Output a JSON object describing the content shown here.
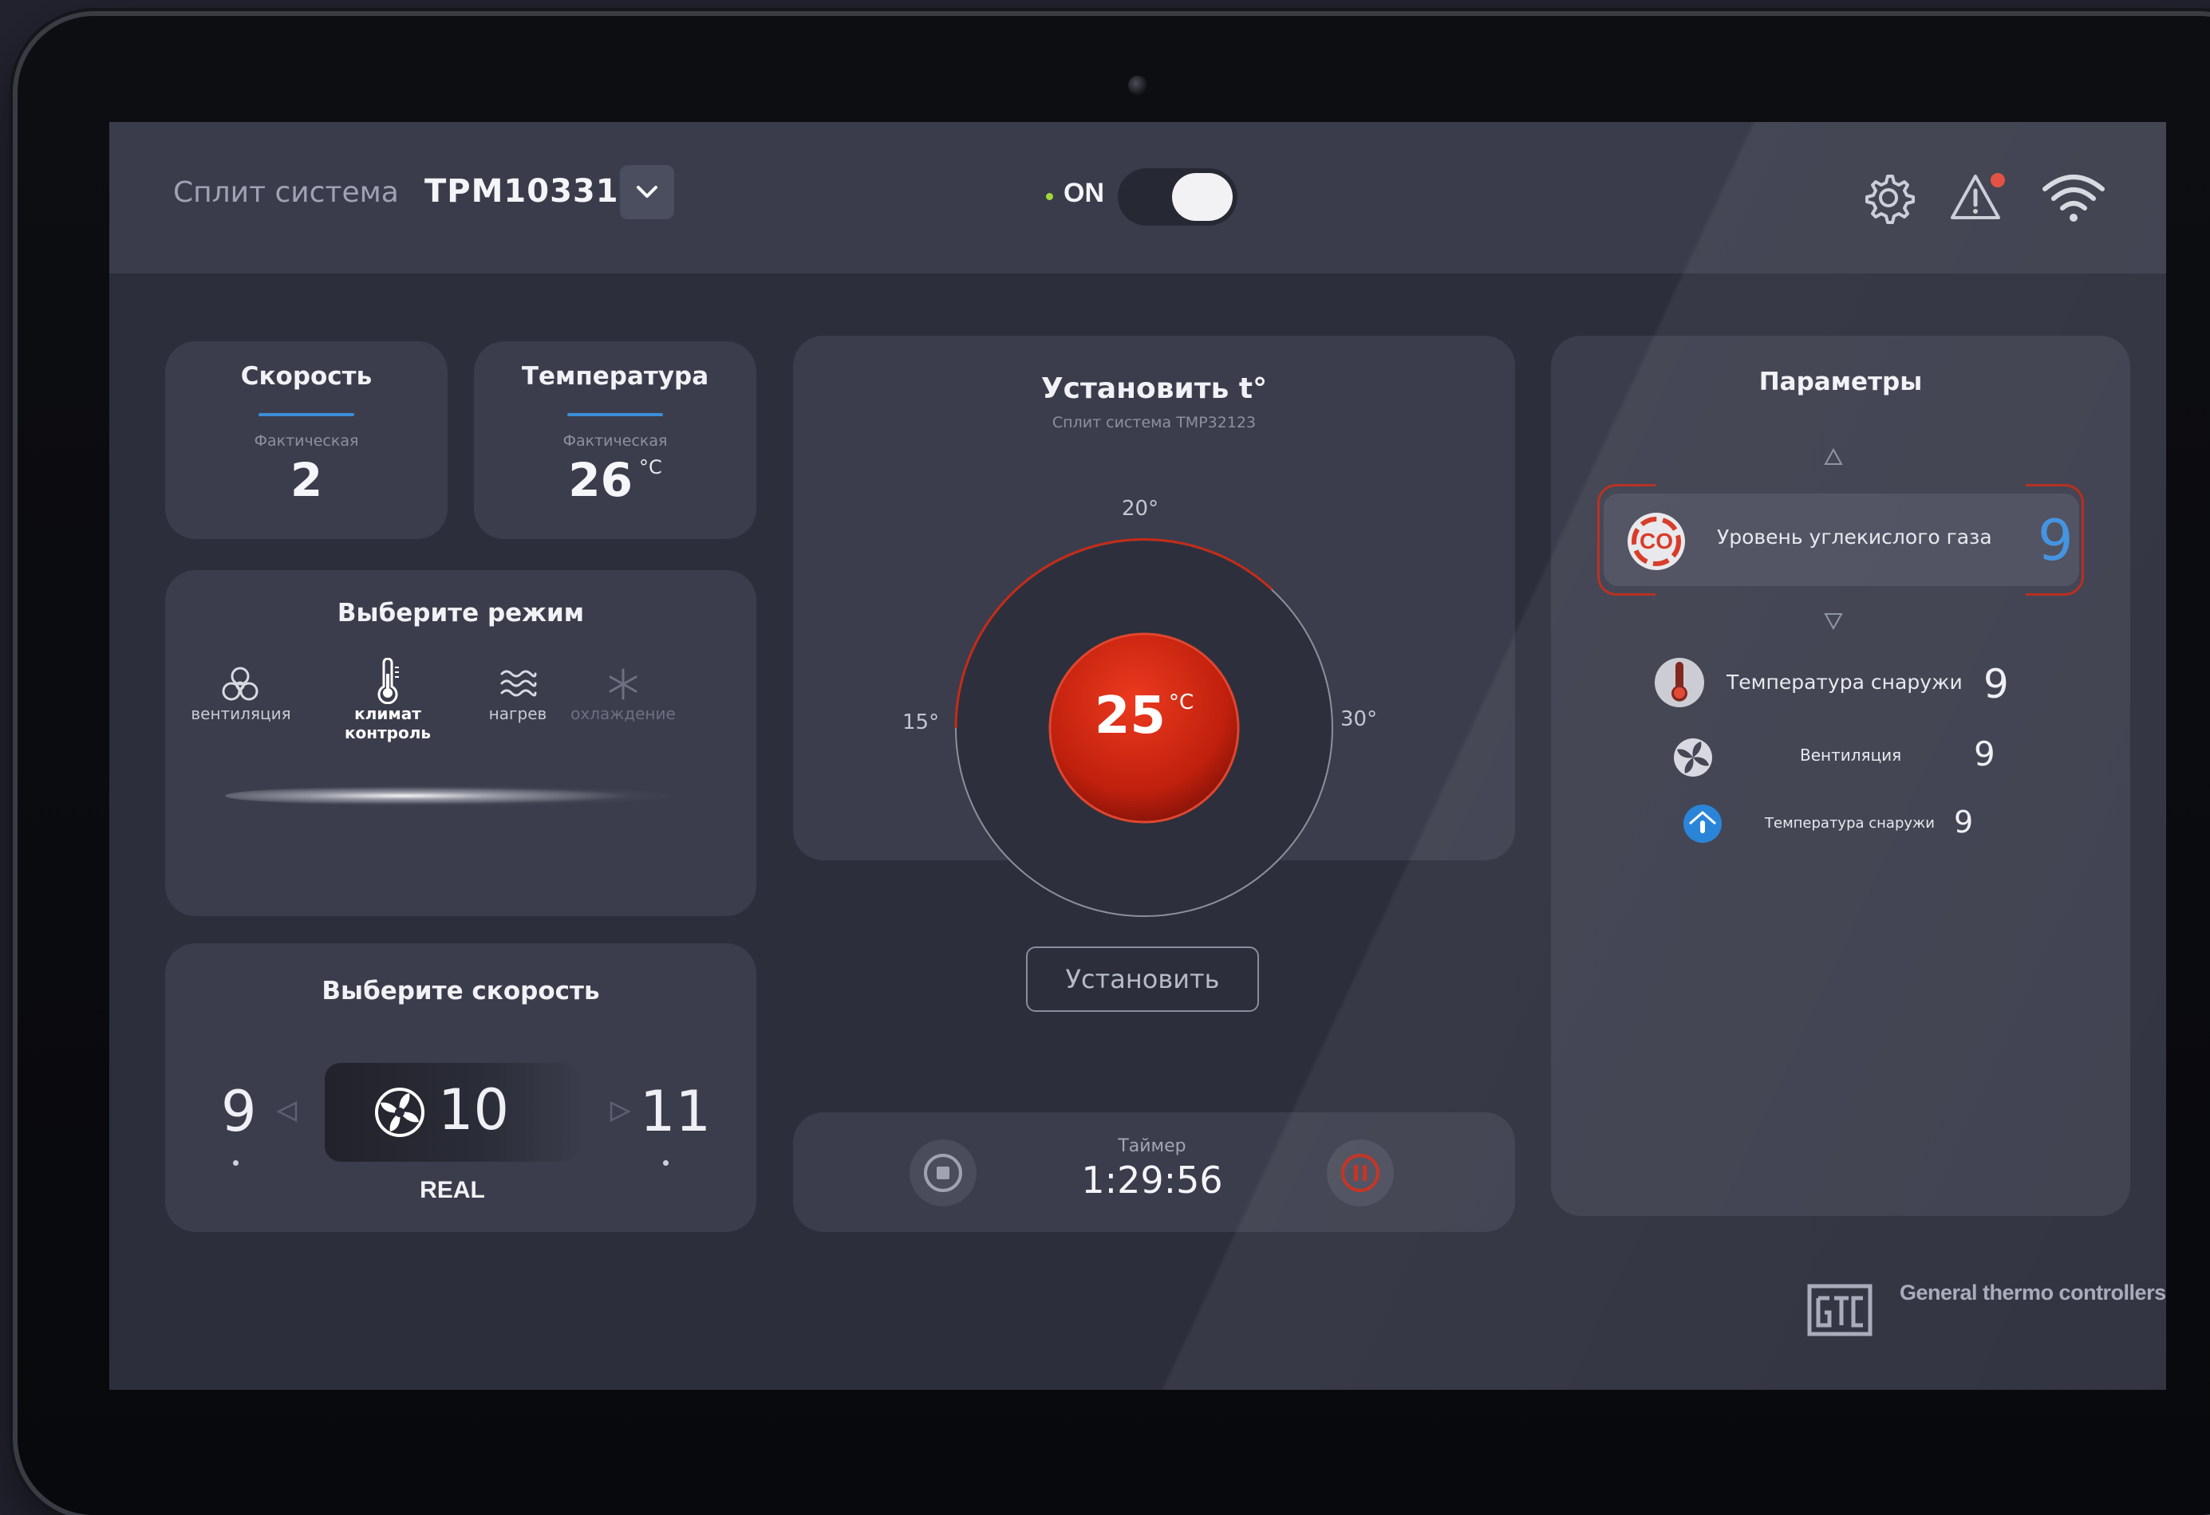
{
  "header": {
    "system_label": "Сплит система",
    "model": "TPM10331",
    "power_state": "ON",
    "power_on": true
  },
  "speed_card": {
    "title": "Скорость",
    "sublabel": "Фактическая",
    "value": "2"
  },
  "temp_card": {
    "title": "Температура",
    "sublabel": "Фактическая",
    "value": "26",
    "unit": "°C"
  },
  "mode_card": {
    "title": "Выберите режим",
    "modes": [
      {
        "label": "вентиляция",
        "icon": "fan-outline-icon",
        "active": false
      },
      {
        "label": "климат контроль",
        "icon": "thermometer-icon",
        "active": true
      },
      {
        "label": "нагрев",
        "icon": "heat-waves-icon",
        "active": false
      },
      {
        "label": "охлаждение",
        "icon": "snowflake-icon",
        "active": false
      }
    ]
  },
  "fan_speed_card": {
    "title": "Выберите скорость",
    "prev": "9",
    "current": "10",
    "next": "11",
    "mode": "REAL"
  },
  "set_temp_card": {
    "title": "Установить t°",
    "subtitle": "Сплит система TMP32123",
    "scale_top": "20°",
    "scale_left": "15°",
    "scale_right": "30°",
    "value": "25",
    "unit": "°C",
    "button": "Установить"
  },
  "timer_card": {
    "label": "Таймер",
    "time": "1:29:56"
  },
  "params_card": {
    "title": "Параметры",
    "selected": {
      "label": "Уровень углекислого газа",
      "value": "9",
      "icon": "co2-icon"
    },
    "items": [
      {
        "label": "Температура снаружи",
        "value": "9",
        "icon": "thermometer-outside-icon"
      },
      {
        "label": "Вентиляция",
        "value": "9",
        "icon": "fan-icon"
      },
      {
        "label": "Температура снаружи",
        "value": "9",
        "icon": "house-temperature-icon"
      }
    ]
  },
  "brand": {
    "name": "General thermo controllers"
  },
  "colors": {
    "accent_red": "#d42a16",
    "accent_blue": "#3d8fe0",
    "on_green": "#a3d63a"
  }
}
